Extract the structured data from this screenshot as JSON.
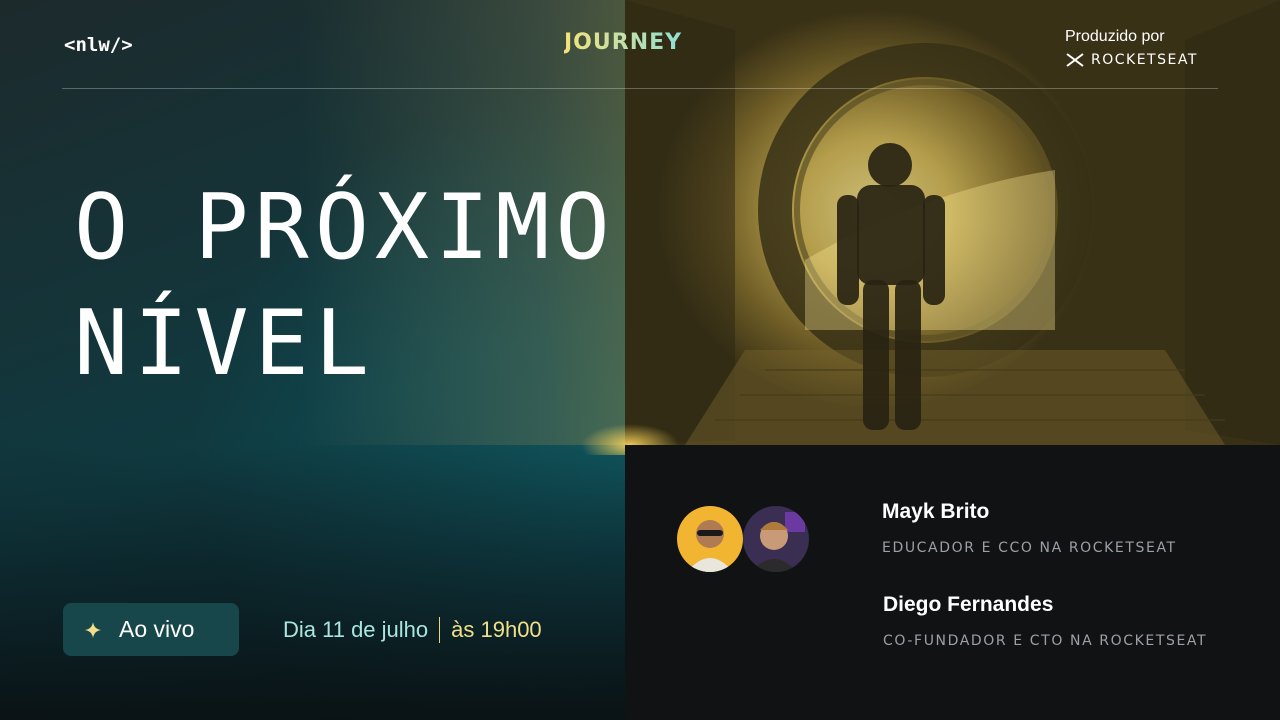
{
  "header": {
    "nlw_logo": "<nlw/>",
    "event_logo": "JOURNEY",
    "produced_by": "Produzido por",
    "producer_name": "ROCKETSEAT"
  },
  "hero": {
    "line1": "O PRÓXIMO",
    "line2": "NÍVEL",
    "image_description_icon": "astronaut-icon"
  },
  "live": {
    "badge_label": "Ao vivo",
    "icon": "sparkle-icon",
    "date": "Dia 11 de julho",
    "time": "às 19h00"
  },
  "speakers": [
    {
      "name": "Mayk Brito",
      "role": "EDUCADOR E CCO NA ROCKETSEAT"
    },
    {
      "name": "Diego Fernandes",
      "role": "CO-FUNDADOR E CTO NA ROCKETSEAT"
    }
  ],
  "colors": {
    "accent_yellow": "#f0e08a",
    "accent_teal": "#a9e6dc",
    "badge_bg": "#17474b",
    "dark_panel": "#101214"
  }
}
